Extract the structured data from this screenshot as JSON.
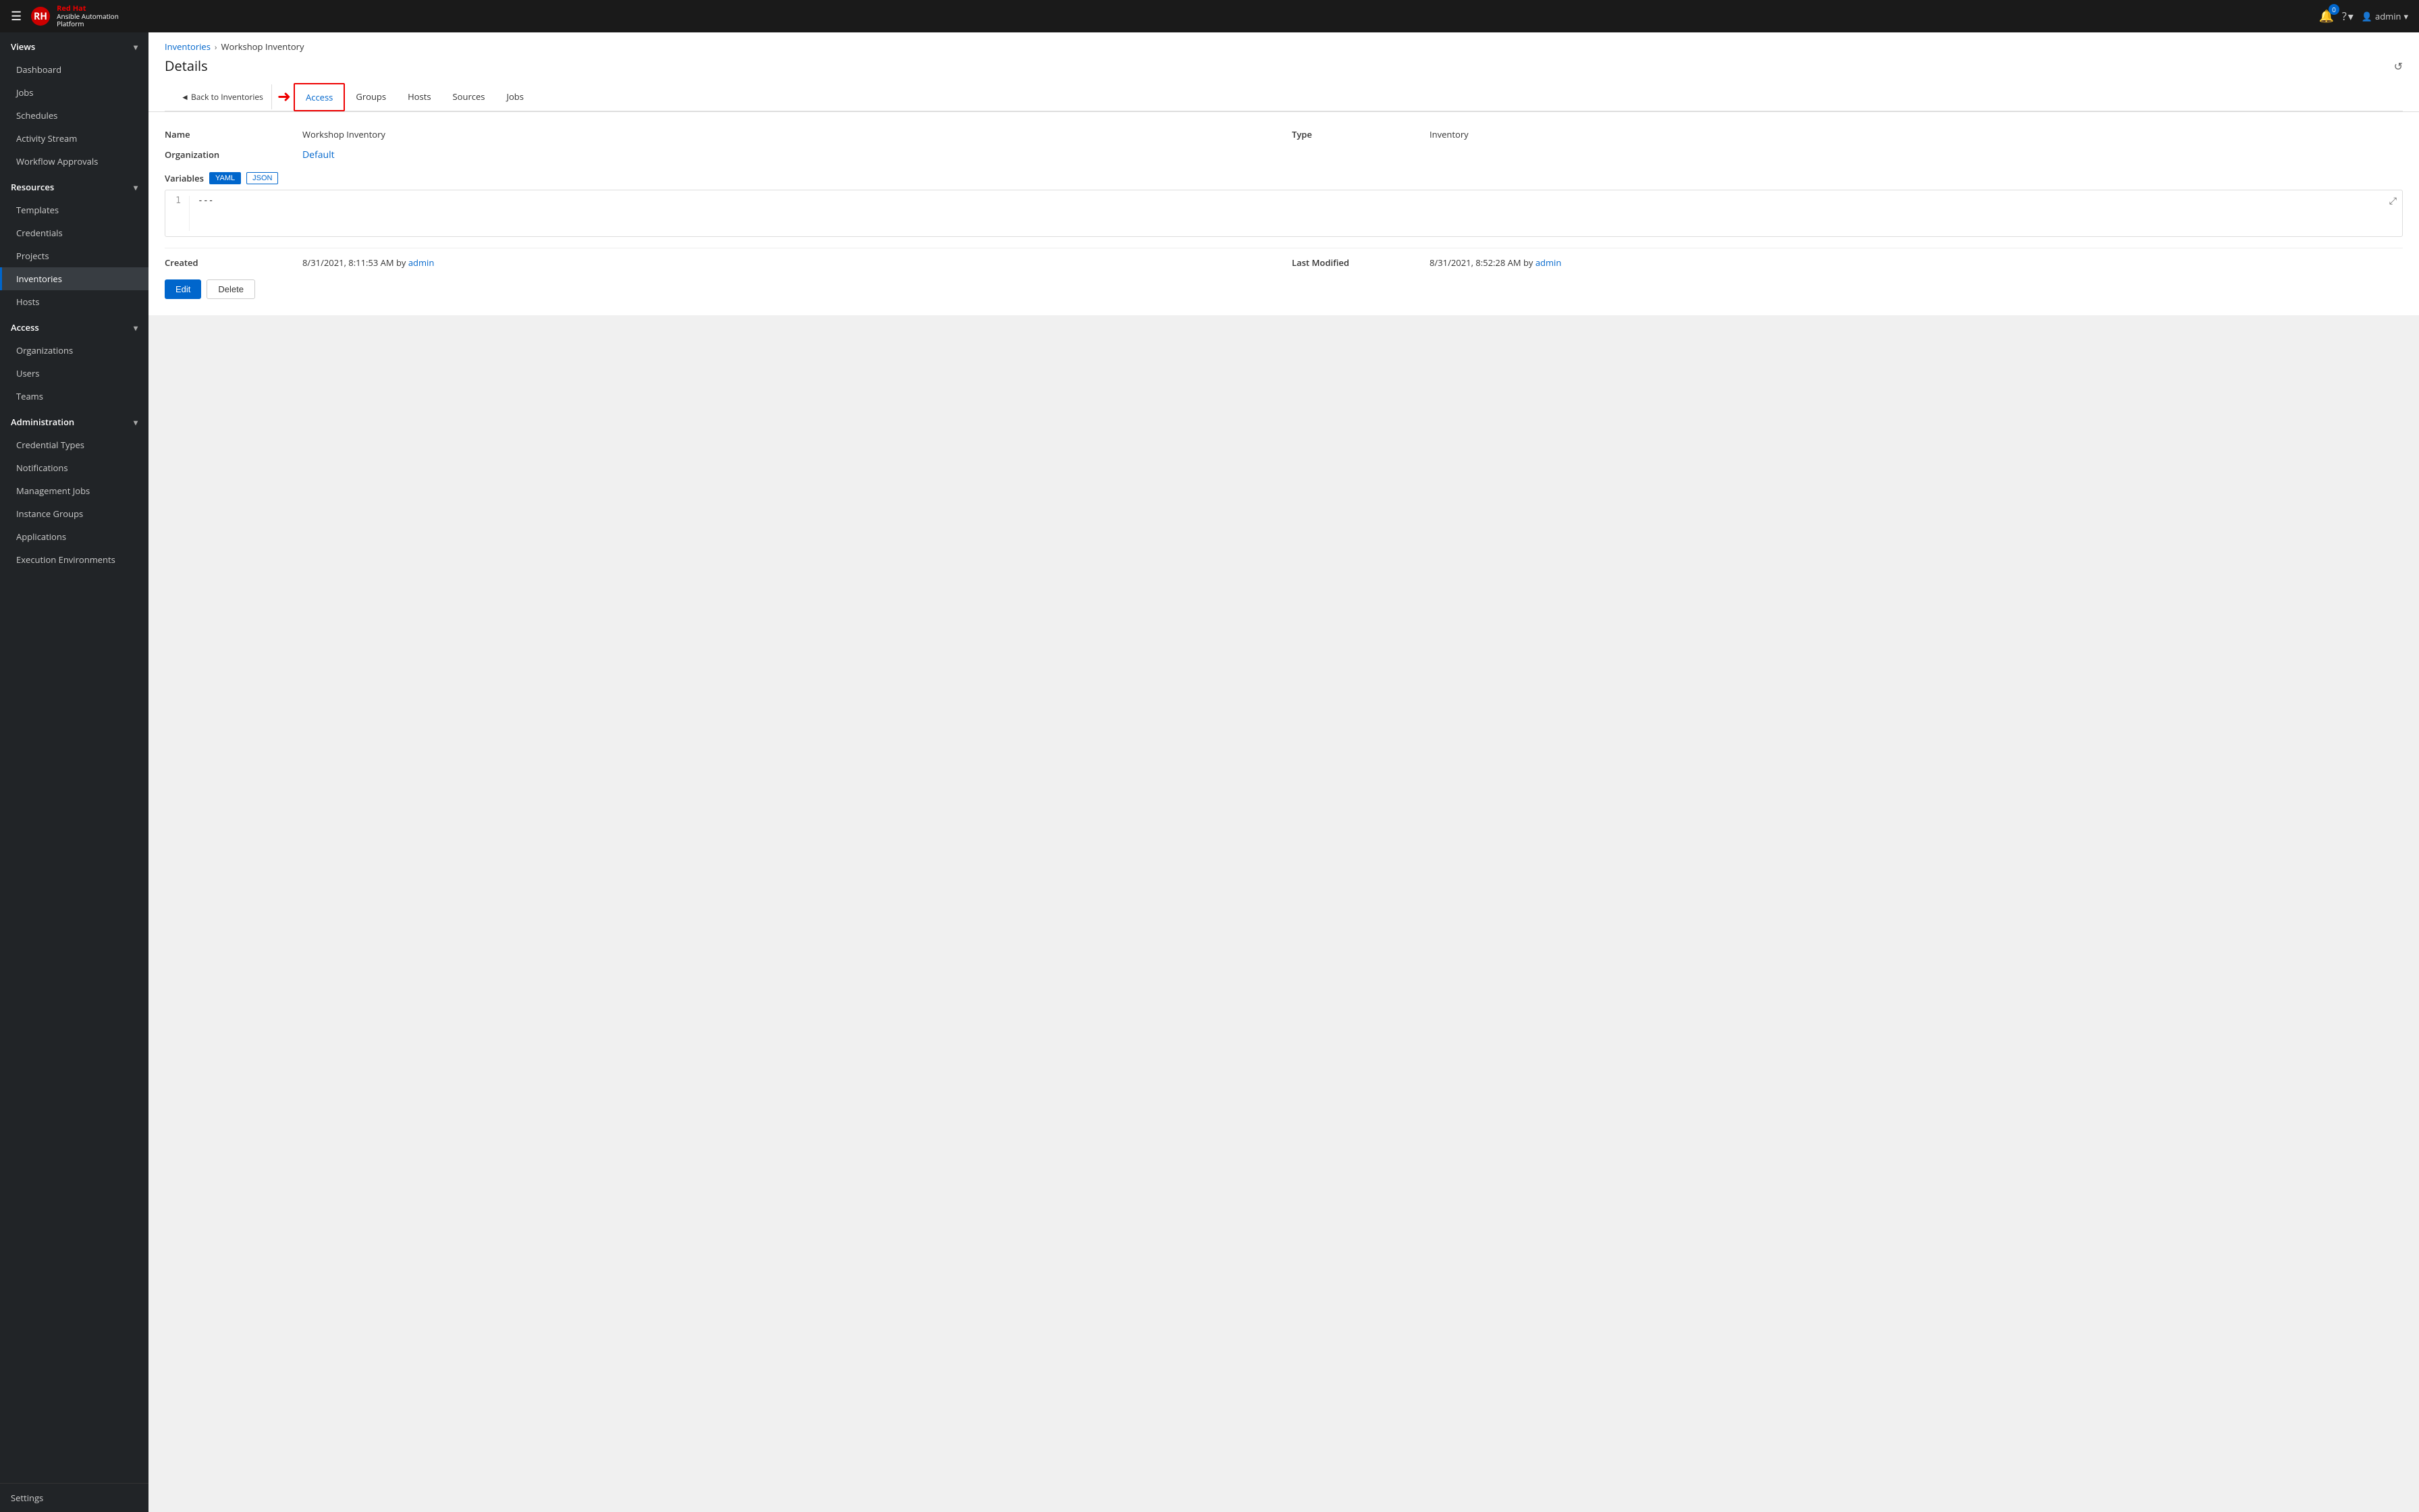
{
  "navbar": {
    "hamburger_label": "☰",
    "logo_brand": "Red Hat",
    "logo_product_line1": "Ansible Automation",
    "logo_product_line2": "Platform",
    "bell_icon": "🔔",
    "notification_count": "0",
    "help_icon": "?",
    "user_icon": "👤",
    "username": "admin",
    "dropdown_icon": "▾"
  },
  "sidebar": {
    "views_label": "Views",
    "views_chevron": "▾",
    "views_items": [
      {
        "label": "Dashboard",
        "active": false
      },
      {
        "label": "Jobs",
        "active": false
      },
      {
        "label": "Schedules",
        "active": false
      },
      {
        "label": "Activity Stream",
        "active": false
      },
      {
        "label": "Workflow Approvals",
        "active": false
      }
    ],
    "resources_label": "Resources",
    "resources_chevron": "▾",
    "resources_items": [
      {
        "label": "Templates",
        "active": false
      },
      {
        "label": "Credentials",
        "active": false
      },
      {
        "label": "Projects",
        "active": false
      },
      {
        "label": "Inventories",
        "active": true
      },
      {
        "label": "Hosts",
        "active": false
      }
    ],
    "access_label": "Access",
    "access_chevron": "▾",
    "access_items": [
      {
        "label": "Organizations",
        "active": false
      },
      {
        "label": "Users",
        "active": false
      },
      {
        "label": "Teams",
        "active": false
      }
    ],
    "administration_label": "Administration",
    "administration_chevron": "▾",
    "administration_items": [
      {
        "label": "Credential Types",
        "active": false
      },
      {
        "label": "Notifications",
        "active": false
      },
      {
        "label": "Management Jobs",
        "active": false
      },
      {
        "label": "Instance Groups",
        "active": false
      },
      {
        "label": "Applications",
        "active": false
      },
      {
        "label": "Execution Environments",
        "active": false
      }
    ],
    "settings_label": "Settings"
  },
  "breadcrumb": {
    "parent_label": "Inventories",
    "separator": "›",
    "current_label": "Workshop Inventory"
  },
  "page": {
    "title": "Details",
    "history_icon": "↺"
  },
  "tabs": {
    "back_label": "◄ Back to Inventories",
    "items": [
      {
        "label": "Access",
        "active": true
      },
      {
        "label": "Groups",
        "active": false
      },
      {
        "label": "Hosts",
        "active": false
      },
      {
        "label": "Sources",
        "active": false
      },
      {
        "label": "Jobs",
        "active": false
      }
    ]
  },
  "details": {
    "name_label": "Name",
    "name_value": "Workshop Inventory",
    "type_label": "Type",
    "type_value": "Inventory",
    "organization_label": "Organization",
    "organization_value": "Default",
    "variables_label": "Variables",
    "yaml_btn": "YAML",
    "json_btn": "JSON",
    "code_line": "1",
    "code_content": "---",
    "created_label": "Created",
    "created_value": "8/31/2021, 8:11:53 AM by",
    "created_user": "admin",
    "last_modified_label": "Last Modified",
    "last_modified_value": "8/31/2021, 8:52:28 AM by",
    "last_modified_user": "admin",
    "edit_btn": "Edit",
    "delete_btn": "Delete"
  }
}
